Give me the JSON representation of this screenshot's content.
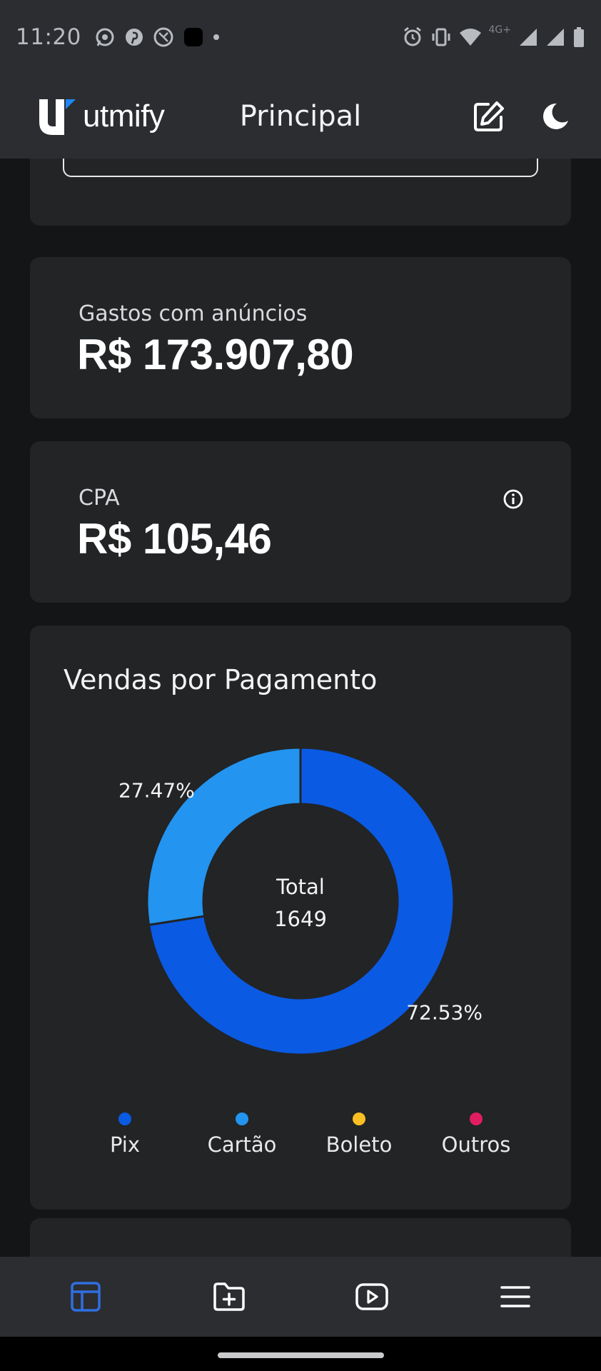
{
  "status_bar": {
    "time": "11:20",
    "left_icons": [
      "whatsapp-icon",
      "pinterest-icon",
      "browser-icon",
      "app-square-icon",
      "dot-icon"
    ],
    "right_icons": [
      "alarm-icon",
      "vibrate-icon",
      "wifi-icon",
      "signal-icon",
      "signal-icon",
      "battery-icon"
    ],
    "network_label": "4G+"
  },
  "header": {
    "logo_text": "utmify",
    "title": "Principal",
    "edit_icon": "edit-icon",
    "theme_icon": "moon-icon"
  },
  "cards": {
    "gastos": {
      "label": "Gastos com anúncios",
      "value": "R$ 173.907,80"
    },
    "cpa": {
      "label": "CPA",
      "value": "R$ 105,46",
      "icon": "info-icon"
    }
  },
  "chart": {
    "title": "Vendas por Pagamento",
    "center_label": "Total",
    "center_value": "1649",
    "legend": [
      {
        "label": "Pix",
        "color": "#0a5ae3"
      },
      {
        "label": "Cartão",
        "color": "#2394f0"
      },
      {
        "label": "Boleto",
        "color": "#fbbf24"
      },
      {
        "label": "Outros",
        "color": "#e11d62"
      }
    ]
  },
  "chart_data": {
    "type": "pie",
    "title": "Vendas por Pagamento",
    "categories": [
      "Pix",
      "Cartão",
      "Boleto",
      "Outros"
    ],
    "values": [
      72.53,
      27.47,
      0,
      0
    ],
    "value_labels": [
      "72.53%",
      "27.47%",
      "",
      ""
    ],
    "colors": [
      "#0a5ae3",
      "#2394f0",
      "#fbbf24",
      "#e11d62"
    ],
    "donut": true,
    "center_text": [
      "Total",
      "1649"
    ],
    "legend": "bottom"
  },
  "bottom_nav": {
    "items": [
      "dashboard-icon",
      "add-folder-icon",
      "video-icon",
      "menu-icon"
    ],
    "active_color": "#2f6fe0"
  }
}
